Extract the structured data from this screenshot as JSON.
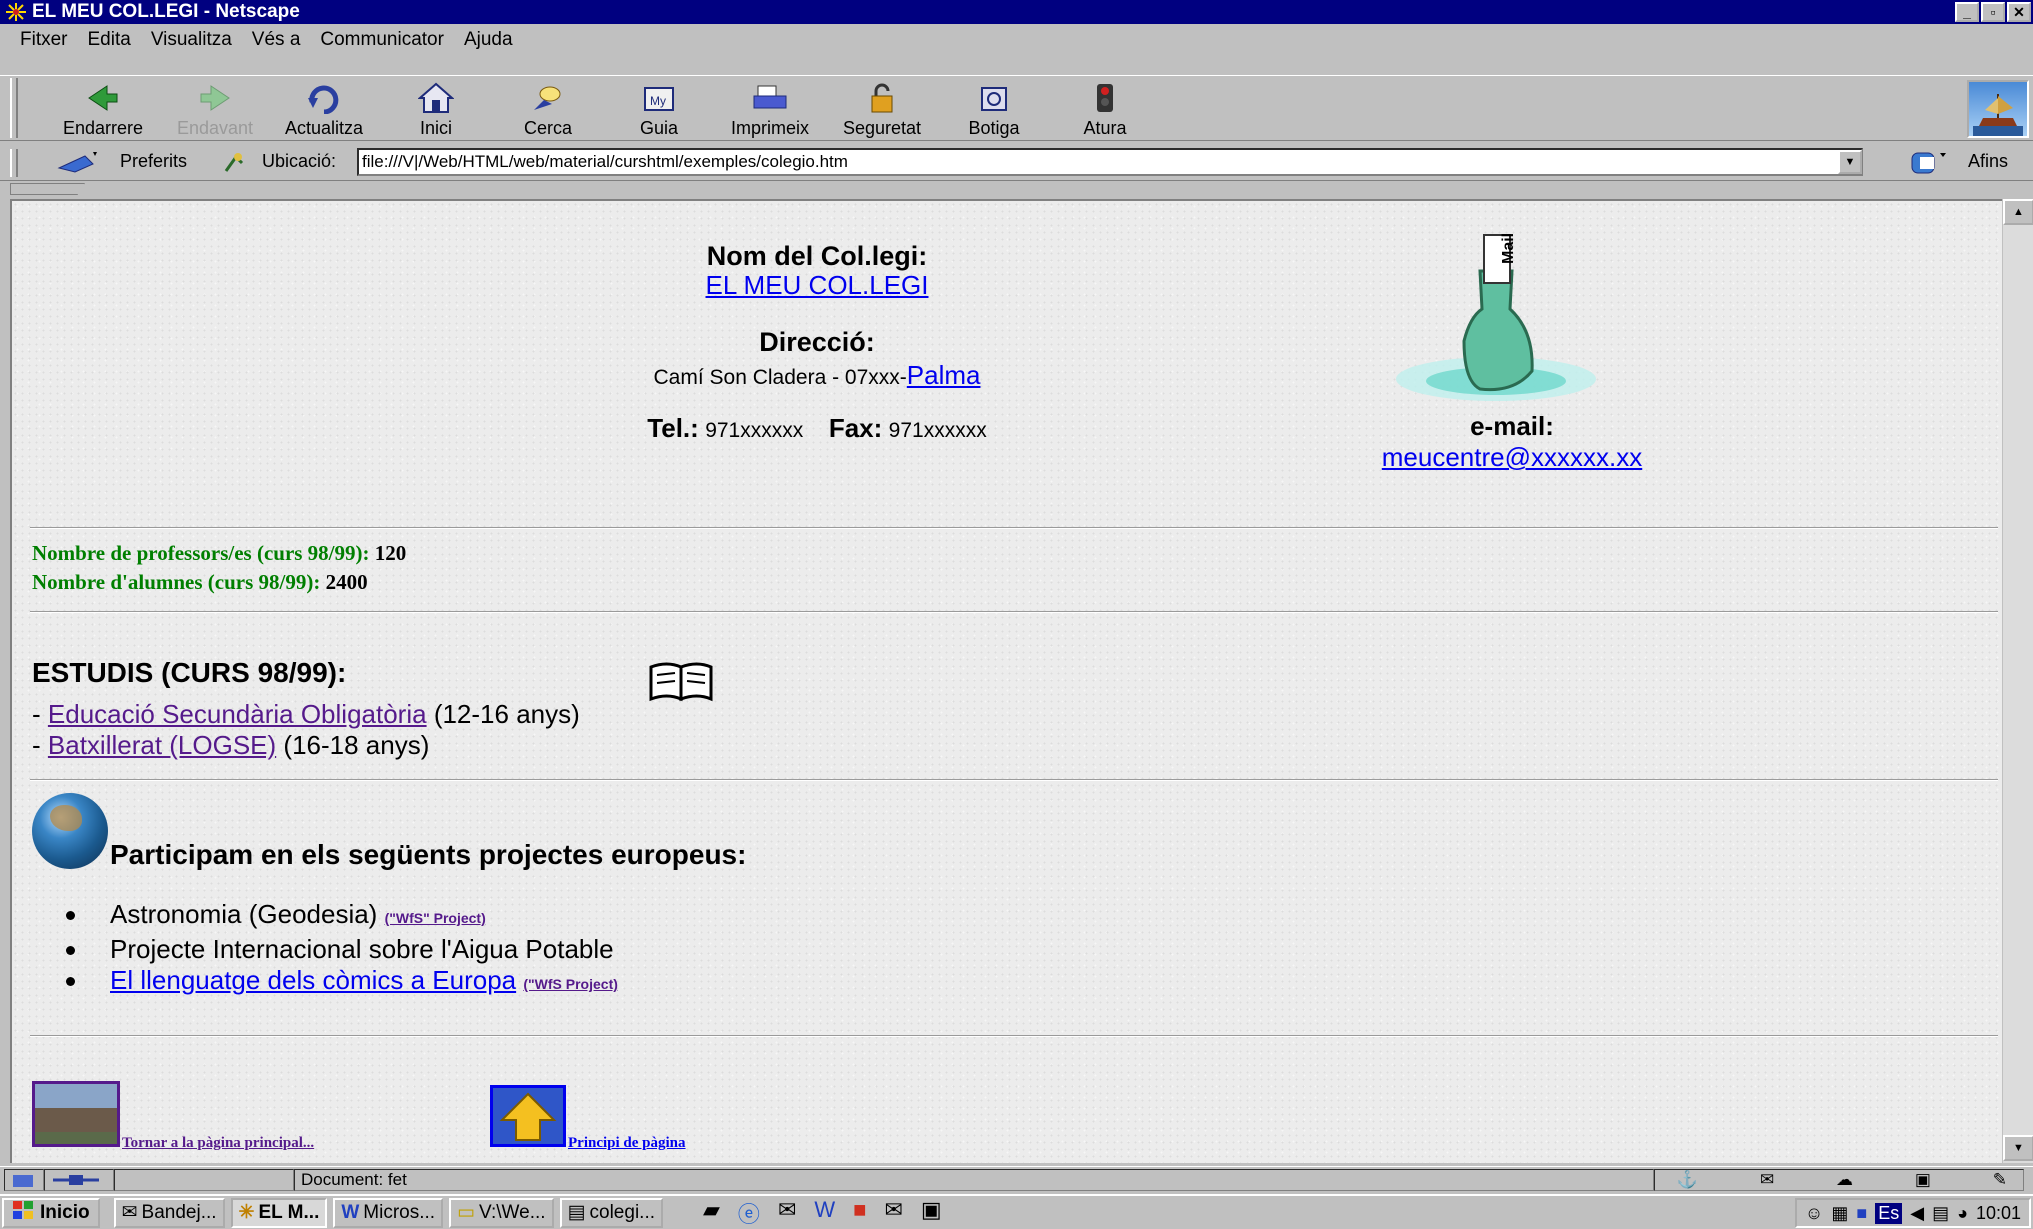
{
  "window": {
    "title": "EL MEU COL.LEGI - Netscape"
  },
  "menu": [
    "Fitxer",
    "Edita",
    "Visualitza",
    "Vés a",
    "Communicator",
    "Ajuda"
  ],
  "toolbar": {
    "back": "Endarrere",
    "forward": "Endavant",
    "reload": "Actualitza",
    "home": "Inici",
    "search": "Cerca",
    "guide": "Guia",
    "print": "Imprimeix",
    "security": "Seguretat",
    "shop": "Botiga",
    "stop": "Atura"
  },
  "location": {
    "bookmarks": "Preferits",
    "label": "Ubicació:",
    "url": "file:///V|/Web/HTML/web/material/curshtml/exemples/colegio.htm",
    "related": "Afins"
  },
  "page": {
    "school_label": "Nom del Col.legi:",
    "school_name": "EL MEU COL.LEGI",
    "address_label": "Direcció:",
    "address_text": "Camí Son Cladera - 07xxx-",
    "city": "Palma",
    "tel_label": "Tel.:",
    "tel_value": "971xxxxxx",
    "fax_label": "Fax:",
    "fax_value": "971xxxxxx",
    "email_label": "e-mail:",
    "email": "meucentre@xxxxxx.xx",
    "teachers_label": "Nombre de professors/es (curs 98/99):",
    "teachers_value": "120",
    "students_label": "Nombre d'alumnes (curs 98/99):",
    "students_value": "2400",
    "studies_title": "ESTUDIS (CURS 98/99):",
    "studies": [
      {
        "name": "Educació Secundària Obligatòria",
        "ages": "(12-16 anys)"
      },
      {
        "name": "Batxillerat (LOGSE)",
        "ages": "(16-18 anys)"
      }
    ],
    "projects_title": "Participam en els següents projectes europeus:",
    "projects": [
      {
        "name": "Astronomia (Geodesia)",
        "tag": "(\"WfS\" Project)"
      },
      {
        "name": "Projecte Internacional sobre l'Aigua Potable"
      },
      {
        "name": "El llenguatge dels còmics a Europa",
        "tag": "(\"WfS Project)"
      }
    ],
    "back_home_link": "Tornar a la pàgina principal...",
    "top_link": "Principi de pàgina"
  },
  "status": {
    "text": "Document: fet"
  },
  "taskbar": {
    "start": "Inicio",
    "tasks": [
      "Bandej...",
      "EL M...",
      "Micros...",
      "V:\\We...",
      "colegi..."
    ],
    "lang": "Es",
    "clock": "10:01"
  }
}
